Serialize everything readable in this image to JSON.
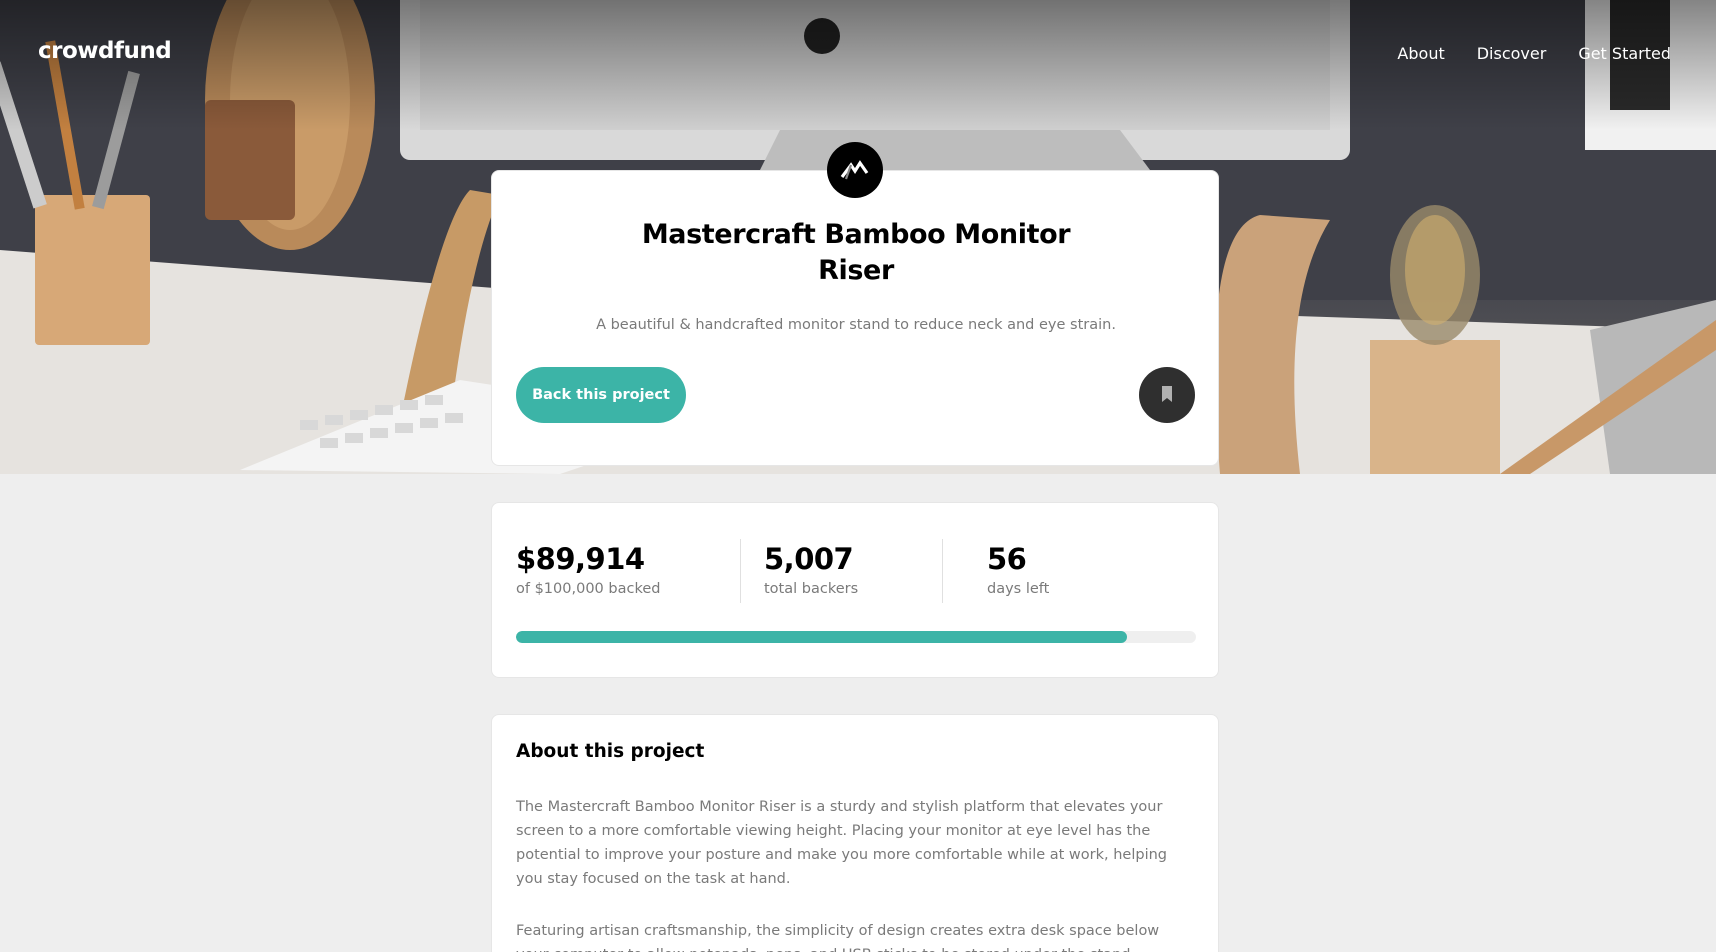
{
  "brand": {
    "logo": "crowdfund"
  },
  "nav": {
    "items": [
      "About",
      "Discover",
      "Get Started"
    ]
  },
  "project": {
    "title": "Mastercraft Bamboo Monitor Riser",
    "description": "A beautiful & handcrafted monitor stand to reduce neck and eye strain.",
    "back_button": "Back this project",
    "bookmark_icon": "bookmark-icon"
  },
  "stats": {
    "backed": {
      "value": "$89,914",
      "label": "of $100,000 backed"
    },
    "backers": {
      "value": "5,007",
      "label": "total backers"
    },
    "days": {
      "value": "56",
      "label": "days left"
    },
    "progress_percent": 89.9
  },
  "about": {
    "heading": "About this project",
    "paragraphs": [
      "The Mastercraft Bamboo Monitor Riser is a sturdy and stylish platform that elevates your screen to a more comfortable viewing height. Placing your monitor at eye level has the potential to improve your posture and make you more comfortable while at work, helping you stay focused on the task at hand.",
      "Featuring artisan craftsmanship, the simplicity of design creates extra desk space below your computer to allow notepads, pens, and USB sticks to be stored under the stand."
    ]
  },
  "colors": {
    "accent": "#3cb4a7",
    "background": "#eeeeee",
    "dark": "#2f2f2f"
  }
}
